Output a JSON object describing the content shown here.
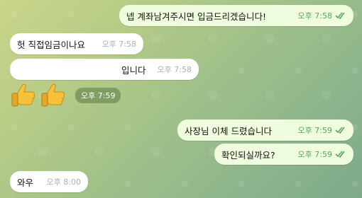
{
  "chat": {
    "messages": [
      {
        "id": "m1",
        "direction": "out",
        "text": "넵 계좌남겨주시면 입금드리겠습니다!",
        "time": "오후 7:58",
        "read": true
      },
      {
        "id": "m2",
        "direction": "in",
        "text": "헛 직접임금이나요",
        "time": "오후 7:58"
      },
      {
        "id": "m3",
        "direction": "in",
        "text": "입니다",
        "time": "오후 7:58"
      },
      {
        "id": "m4",
        "direction": "in",
        "emoji": "thumbs-up x2",
        "time": "오후 7:59"
      },
      {
        "id": "m5",
        "direction": "out",
        "text": "사장님 이체 드렸습니다",
        "time": "오후 7:59",
        "read": true
      },
      {
        "id": "m6",
        "direction": "out",
        "text": "확인되실까요?",
        "time": "오후 7:59",
        "read": true
      },
      {
        "id": "m7",
        "direction": "in",
        "text": "와우",
        "time": "오후 8:00"
      }
    ]
  },
  "colors": {
    "incoming_bubble": "#ffffff",
    "outgoing_bubble": "#effdde",
    "outgoing_time": "#5aa35a",
    "thumb": "#f7c23a"
  }
}
